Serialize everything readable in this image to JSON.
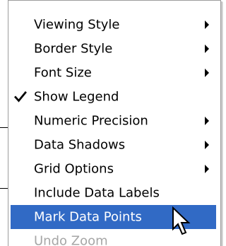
{
  "menu": {
    "items": [
      {
        "label": "Viewing Style",
        "checked": false,
        "submenu": true,
        "state": "normal"
      },
      {
        "label": "Border Style",
        "checked": false,
        "submenu": true,
        "state": "normal"
      },
      {
        "label": "Font Size",
        "checked": false,
        "submenu": true,
        "state": "normal"
      },
      {
        "label": "Show Legend",
        "checked": true,
        "submenu": false,
        "state": "normal"
      },
      {
        "label": "Numeric Precision",
        "checked": false,
        "submenu": true,
        "state": "normal"
      },
      {
        "label": "Data Shadows",
        "checked": false,
        "submenu": true,
        "state": "normal"
      },
      {
        "label": "Grid Options",
        "checked": false,
        "submenu": true,
        "state": "normal"
      },
      {
        "label": "Include Data Labels",
        "checked": false,
        "submenu": false,
        "state": "normal"
      },
      {
        "label": "Mark Data Points",
        "checked": false,
        "submenu": false,
        "state": "highlighted"
      },
      {
        "label": "Undo Zoom",
        "checked": false,
        "submenu": false,
        "state": "disabled"
      }
    ]
  },
  "colors": {
    "highlight": "#316ac5",
    "disabled_text": "#a6a6a6"
  },
  "cursor": {
    "icon": "arrow-pointer-icon"
  }
}
